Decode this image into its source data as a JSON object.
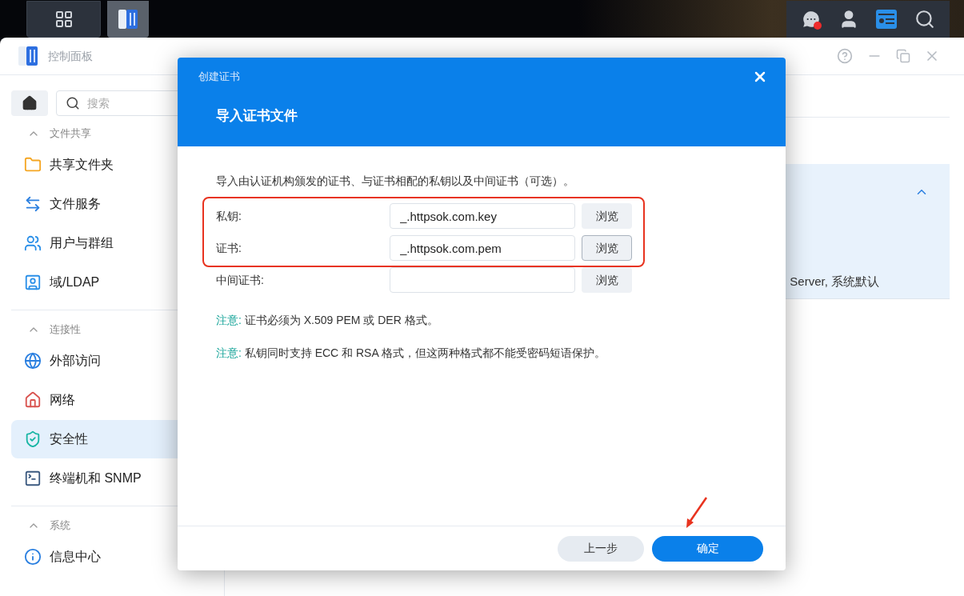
{
  "window": {
    "title": "控制面板"
  },
  "sidebar": {
    "search": {
      "placeholder": "搜索"
    },
    "sections": [
      {
        "title": "文件共享",
        "expanded": true,
        "items": [
          {
            "label": "共享文件夹",
            "kind": "folder",
            "selected": false
          },
          {
            "label": "文件服务",
            "kind": "services",
            "selected": false
          },
          {
            "label": "用户与群组",
            "kind": "users",
            "selected": false
          },
          {
            "label": "域/LDAP",
            "kind": "domain",
            "selected": false
          }
        ]
      },
      {
        "title": "连接性",
        "expanded": true,
        "items": [
          {
            "label": "外部访问",
            "kind": "globe",
            "selected": false
          },
          {
            "label": "网络",
            "kind": "network",
            "selected": false
          },
          {
            "label": "安全性",
            "kind": "shield",
            "selected": true
          },
          {
            "label": "终端机和 SNMP",
            "kind": "terminal",
            "selected": false
          }
        ]
      },
      {
        "title": "系统",
        "expanded": true,
        "items": [
          {
            "label": "信息中心",
            "kind": "info",
            "selected": false
          }
        ]
      }
    ]
  },
  "main": {
    "panel_text": "Server, 系统默认",
    "panel_expanded": true
  },
  "dialog": {
    "title": "创建证书",
    "heading": "导入证书文件",
    "intro": "导入由认证机构颁发的证书、与证书相配的私钥以及中间证书（可选）。",
    "fields": [
      {
        "label": "私钥:",
        "value": "_.httpsok.com.key",
        "button": "浏览",
        "focused": false,
        "highlighted": true
      },
      {
        "label": "证书:",
        "value": "_.httpsok.com.pem",
        "button": "浏览",
        "focused": true,
        "highlighted": true
      },
      {
        "label": "中间证书:",
        "button": "浏览",
        "focused": false,
        "highlighted": false
      }
    ],
    "notes": [
      {
        "label": "注意:",
        "text": "证书必须为 X.509 PEM 或 DER 格式。"
      },
      {
        "label": "注意:",
        "text": "私钥同时支持 ECC 和 RSA 格式，但这两种格式都不能受密码短语保护。"
      }
    ],
    "back": "上一步",
    "confirm": "确定"
  }
}
